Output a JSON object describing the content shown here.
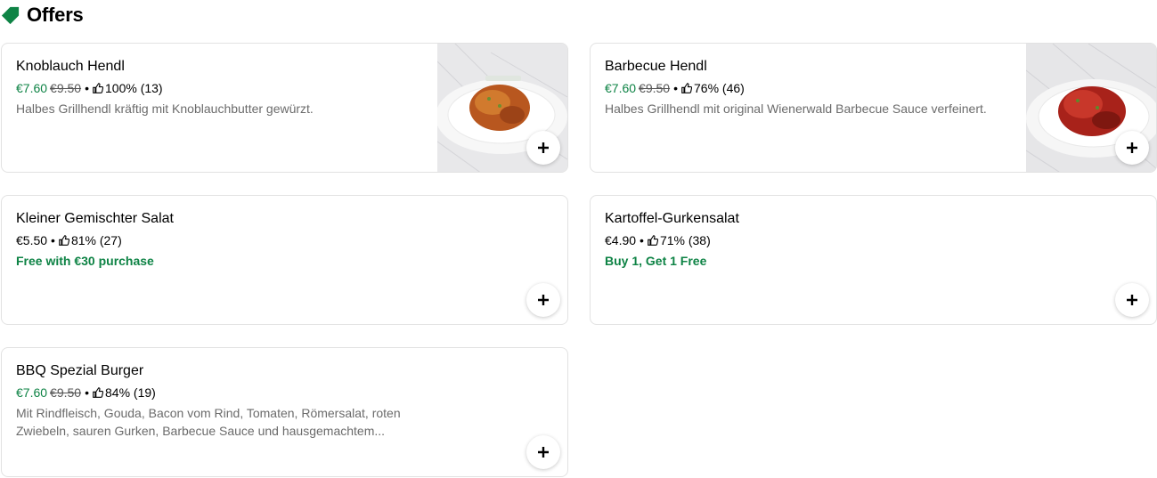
{
  "section": {
    "title": "Offers",
    "icon": "tag-icon",
    "accent": "#0e8345"
  },
  "items": [
    {
      "name": "Knoblauch Hendl",
      "price": "€7.60",
      "old_price": "€9.50",
      "rating": "100% (13)",
      "description": "Halbes Grillhendl kräftig mit Knoblauchbutter gewürzt.",
      "image": "roast-chicken-garlic"
    },
    {
      "name": "Barbecue Hendl",
      "price": "€7.60",
      "old_price": "€9.50",
      "rating": "76% (46)",
      "description": "Halbes Grillhendl mit original Wienerwald Barbecue Sauce verfeinert.",
      "image": "roast-chicken-bbq"
    },
    {
      "name": "Kleiner Gemischter Salat",
      "price": "€5.50",
      "rating": "81% (27)",
      "promo": "Free with €30 purchase"
    },
    {
      "name": "Kartoffel-Gurkensalat",
      "price": "€4.90",
      "rating": "71% (38)",
      "promo": "Buy 1, Get 1 Free"
    },
    {
      "name": "BBQ Spezial Burger",
      "price": "€7.60",
      "old_price": "€9.50",
      "rating": "84% (19)",
      "description": "Mit Rindfleisch, Gouda, Bacon vom Rind, Tomaten, Römersalat, roten Zwiebeln, sauren Gurken, Barbecue Sauce und hausgemachtem..."
    }
  ],
  "separator": "•",
  "icons": {
    "rating": "thumbs-up-icon",
    "add": "plus-icon"
  },
  "colors": {
    "discount_price": "#0e8345",
    "promo_text": "#0e8345",
    "description": "#6b6b6b",
    "border": "#e2e2e2"
  }
}
